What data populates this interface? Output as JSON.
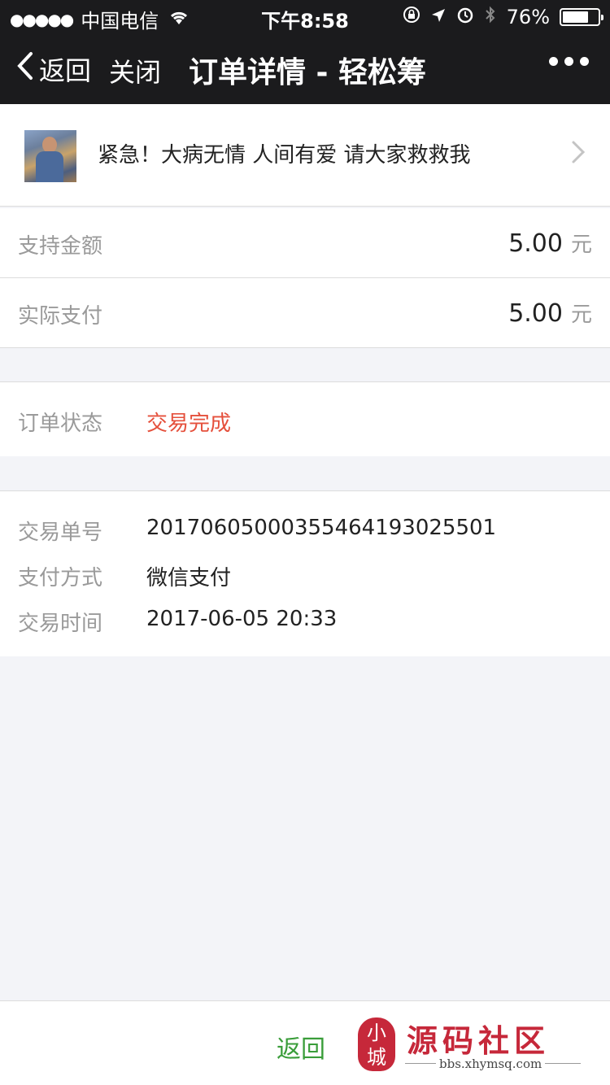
{
  "status_bar": {
    "signal": "●●●●●",
    "carrier": "中国电信",
    "time": "下午8:58",
    "battery": "76%",
    "battery_level": 0.76
  },
  "nav": {
    "back_label": "返回",
    "close_label": "关闭",
    "title": "订单详情 - 轻松筹"
  },
  "campaign": {
    "title": "紧急！大病无情 人间有爱 请大家救救我"
  },
  "amounts": {
    "support_label": "支持金额",
    "support_value": "5.00",
    "actual_label": "实际支付",
    "actual_value": "5.00",
    "unit": "元"
  },
  "order_status": {
    "label": "订单状态",
    "value": "交易完成"
  },
  "info": {
    "trade_no_label": "交易单号",
    "trade_no_value": "20170605000355464193025501",
    "pay_method_label": "支付方式",
    "pay_method_value": "微信支付",
    "trade_time_label": "交易时间",
    "trade_time_value": "2017-06-05 20:33"
  },
  "bottom": {
    "back_label": "返回"
  },
  "watermark": {
    "seal_text": "小\n城",
    "brand": "源码社区",
    "url": "bbs.xhymsq.com"
  },
  "colors": {
    "status_complete": "#e5503c",
    "back_green": "#3a9d3a",
    "brand_red": "#c6283a"
  },
  "icons": [
    "wifi-icon",
    "orientation-lock-icon",
    "location-icon",
    "alarm-icon",
    "bluetooth-icon",
    "battery-icon",
    "back-chevron-icon",
    "more-icon",
    "chevron-right-icon"
  ]
}
